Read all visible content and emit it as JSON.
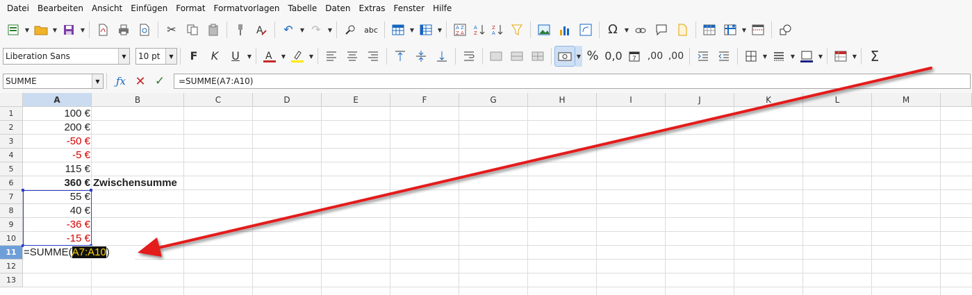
{
  "menu": [
    "Datei",
    "Bearbeiten",
    "Ansicht",
    "Einfügen",
    "Format",
    "Formatvorlagen",
    "Tabelle",
    "Daten",
    "Extras",
    "Fenster",
    "Hilfe"
  ],
  "font": {
    "name": "Liberation Sans",
    "size": "10 pt"
  },
  "toolbar2_glyphs": {
    "bold": "F",
    "italic": "K",
    "underline": "U",
    "percent": "%",
    "decimal": "0,0",
    "add_decimal": ",00",
    "del_decimal": ",00",
    "sum": "Σ"
  },
  "name_box": "SUMME",
  "formula": "=SUMME(A7:A10)",
  "columns": [
    "A",
    "B",
    "C",
    "D",
    "E",
    "F",
    "G",
    "H",
    "I",
    "J",
    "K",
    "L",
    "M"
  ],
  "rows": [
    "1",
    "2",
    "3",
    "4",
    "5",
    "6",
    "7",
    "8",
    "9",
    "10",
    "11",
    "12",
    "13"
  ],
  "cells": {
    "A1": "100 €",
    "A2": "200 €",
    "A3": "-50 €",
    "A4": "-5 €",
    "A5": "115 €",
    "A6": "360 €",
    "B6": "Zwischensumme",
    "A7": "55 €",
    "A8": "40 €",
    "A9": "-36 €",
    "A10": "-15 €"
  },
  "edit_cell": {
    "prefix": "=SUMME(",
    "ref": "A7:A10",
    "suffix": ")"
  },
  "colors": {
    "negative": "#d40000",
    "selection": "#2a3fc9",
    "arrow": "#e31b1b"
  }
}
